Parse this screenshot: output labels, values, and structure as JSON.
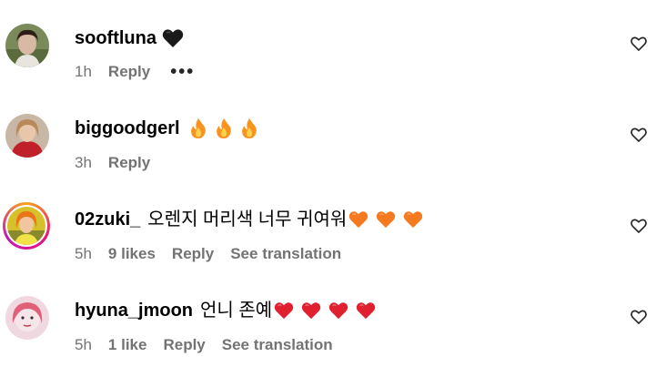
{
  "comments": [
    {
      "username": "sooftluna",
      "text": "",
      "emojis": [
        "black-heart"
      ],
      "time": "1h",
      "likes": "",
      "reply": "Reply",
      "translation": "",
      "more": "•••"
    },
    {
      "username": "biggoodgerl",
      "text": "",
      "emojis": [
        "fire",
        "fire",
        "fire"
      ],
      "time": "3h",
      "likes": "",
      "reply": "Reply",
      "translation": ""
    },
    {
      "username": "02zuki_",
      "text": "오렌지 머리색 너무 귀여워",
      "emojis": [
        "orange-heart",
        "orange-heart",
        "orange-heart"
      ],
      "time": "5h",
      "likes": "9 likes",
      "reply": "Reply",
      "translation": "See translation"
    },
    {
      "username": "hyuna_jmoon",
      "text": "언니 존예",
      "emojis": [
        "red-heart",
        "red-heart",
        "red-heart",
        "red-heart"
      ],
      "time": "5h",
      "likes": "1 like",
      "reply": "Reply",
      "translation": "See translation"
    }
  ],
  "colors": {
    "meta_text": "#737373",
    "black_heart": "#1a1a1a",
    "orange_heart": "#f4791f",
    "red_heart": "#e0202f",
    "fire": "#f7931e"
  }
}
